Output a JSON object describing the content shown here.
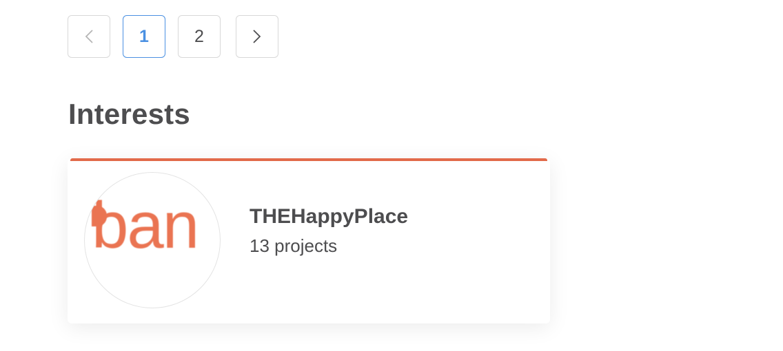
{
  "pagination": {
    "prev_icon": "chevron-left-icon",
    "next_icon": "chevron-right-icon",
    "pages": [
      "1",
      "2"
    ],
    "current_page": "1",
    "active_color": "#4a90e2"
  },
  "interests": {
    "title": "Interests",
    "accent_color": "#e26a4a",
    "items": [
      {
        "logo_text": "ban",
        "logo_color": "#ea7452",
        "name": "THEHappyPlace",
        "projects": "13 projects"
      }
    ]
  }
}
